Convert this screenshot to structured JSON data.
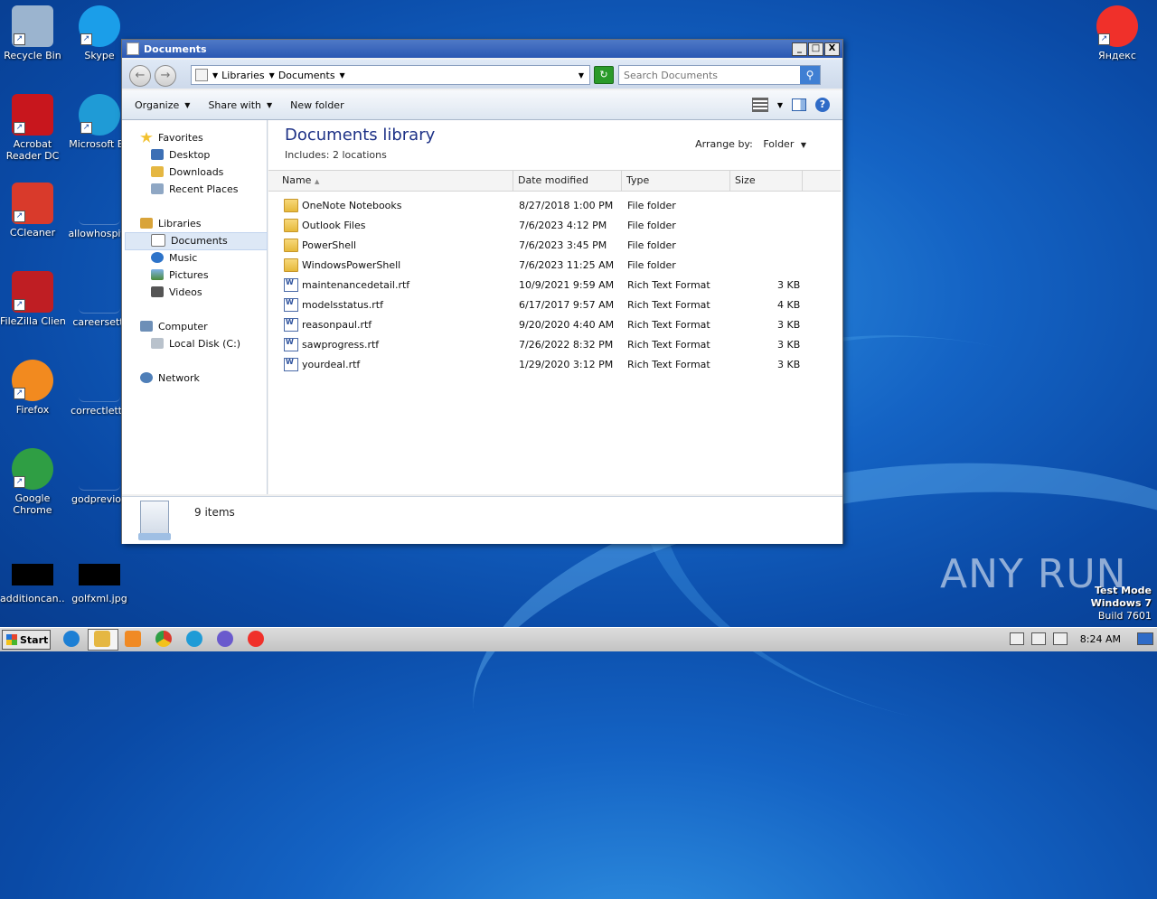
{
  "desktop": {
    "icons": [
      {
        "label": "Recycle Bin",
        "icon": "recycle-bin-icon",
        "color": "#9bb4cf"
      },
      {
        "label": "Skype",
        "icon": "skype-icon",
        "color": "#1b9ee9"
      },
      {
        "label": "Acrobat\nReader DC",
        "icon": "acrobat-icon",
        "color": "#c8161d"
      },
      {
        "label": "Microsoft Ed",
        "icon": "edge-icon",
        "color": "#1f9bd6"
      },
      {
        "label": "CCleaner",
        "icon": "ccleaner-icon",
        "color": "#d93a2b"
      },
      {
        "label": "allowhospita",
        "icon": "file-icon",
        "color": "#1463c4"
      },
      {
        "label": "FileZilla Client",
        "icon": "filezilla-icon",
        "color": "#bf1e23"
      },
      {
        "label": "careersetti",
        "icon": "file-icon",
        "color": "#1463c4"
      },
      {
        "label": "Firefox",
        "icon": "firefox-icon",
        "color": "#f28a1f"
      },
      {
        "label": "correctlette",
        "icon": "file-icon",
        "color": "#1463c4"
      },
      {
        "label": "Google\nChrome",
        "icon": "chrome-icon",
        "color": "#2f9e44"
      },
      {
        "label": "godpreviou",
        "icon": "file-icon",
        "color": "#1463c4"
      },
      {
        "label": "additioncan...",
        "icon": "image-thumb-icon",
        "color": "#000000"
      },
      {
        "label": "golfxml.jpg",
        "icon": "image-thumb-icon",
        "color": "#000000"
      },
      {
        "label": "Яндекс",
        "icon": "yandex-icon",
        "color": "#f0302a"
      }
    ]
  },
  "window": {
    "title": "Documents",
    "buttons": {
      "minimize": "_",
      "maximize": "□",
      "close": "X"
    },
    "address": {
      "crumbs": [
        "Libraries",
        "Documents"
      ]
    },
    "search": {
      "placeholder": "Search Documents"
    },
    "toolbar": {
      "organize": "Organize",
      "share_with": "Share with",
      "new_folder": "New folder"
    },
    "nav": {
      "favorites": "Favorites",
      "desktop": "Desktop",
      "downloads": "Downloads",
      "recent_places": "Recent Places",
      "libraries": "Libraries",
      "documents": "Documents",
      "music": "Music",
      "pictures": "Pictures",
      "videos": "Videos",
      "computer": "Computer",
      "local_disk": "Local Disk (C:)",
      "network": "Network"
    },
    "library": {
      "title": "Documents library",
      "includes_label": "Includes:",
      "includes_value": "2 locations",
      "arrange_label": "Arrange by:",
      "arrange_value": "Folder"
    },
    "columns": {
      "name": "Name",
      "date": "Date modified",
      "type": "Type",
      "size": "Size"
    },
    "files": [
      {
        "name": "OneNote Notebooks",
        "date": "8/27/2018 1:00 PM",
        "type": "File folder",
        "size": "",
        "kind": "folder"
      },
      {
        "name": "Outlook Files",
        "date": "7/6/2023 4:12 PM",
        "type": "File folder",
        "size": "",
        "kind": "folder"
      },
      {
        "name": "PowerShell",
        "date": "7/6/2023 3:45 PM",
        "type": "File folder",
        "size": "",
        "kind": "folder"
      },
      {
        "name": "WindowsPowerShell",
        "date": "7/6/2023 11:25 AM",
        "type": "File folder",
        "size": "",
        "kind": "folder"
      },
      {
        "name": "maintenancedetail.rtf",
        "date": "10/9/2021 9:59 AM",
        "type": "Rich Text Format",
        "size": "3 KB",
        "kind": "doc"
      },
      {
        "name": "modelsstatus.rtf",
        "date": "6/17/2017 9:57 AM",
        "type": "Rich Text Format",
        "size": "4 KB",
        "kind": "doc"
      },
      {
        "name": "reasonpaul.rtf",
        "date": "9/20/2020 4:40 AM",
        "type": "Rich Text Format",
        "size": "3 KB",
        "kind": "doc"
      },
      {
        "name": "sawprogress.rtf",
        "date": "7/26/2022 8:32 PM",
        "type": "Rich Text Format",
        "size": "3 KB",
        "kind": "doc"
      },
      {
        "name": "yourdeal.rtf",
        "date": "1/29/2020 3:12 PM",
        "type": "Rich Text Format",
        "size": "3 KB",
        "kind": "doc"
      }
    ],
    "status": {
      "items": "9 items"
    }
  },
  "taskbar": {
    "start": "Start",
    "clock": "8:24 AM"
  },
  "watermark": {
    "line1": "Test Mode",
    "line2": "Windows 7",
    "line3": "Build 7601",
    "anyrun": "ANY RUN"
  }
}
